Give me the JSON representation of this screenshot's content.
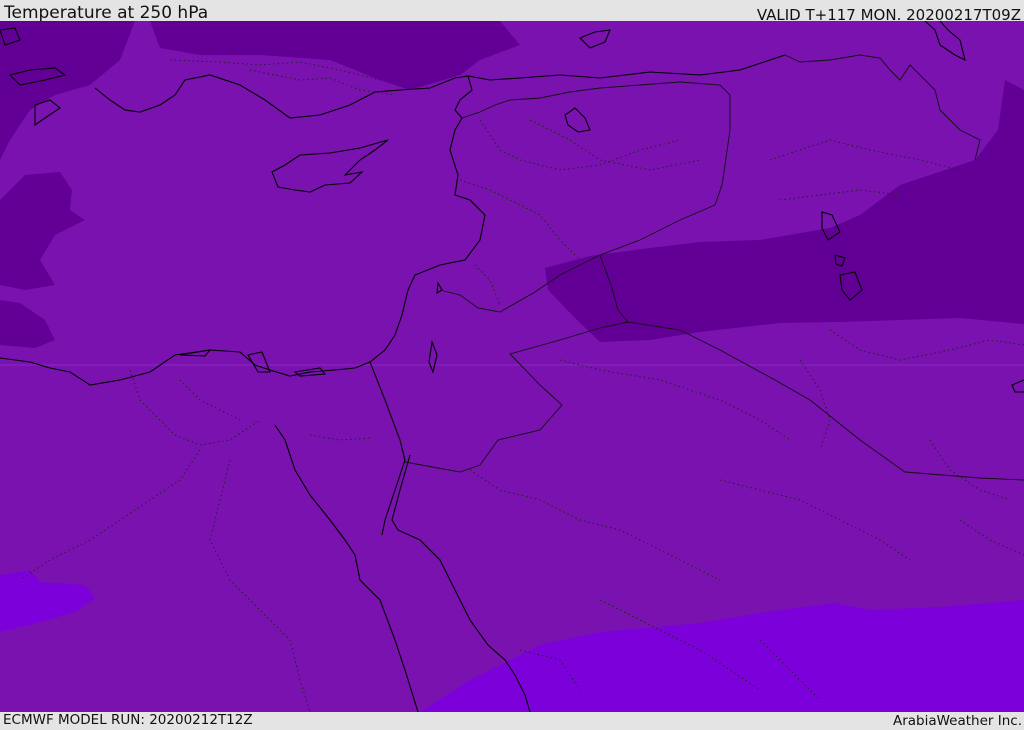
{
  "header": {
    "title": "Temperature at 250 hPa",
    "valid": "VALID T+117 MON. 20200217T09Z"
  },
  "footer": {
    "model_run": "ECMWF MODEL RUN: 20200212T12Z",
    "credit": "ArabiaWeather Inc."
  },
  "map": {
    "region": "Eastern Mediterranean / Middle East",
    "colors": {
      "band_purple": "#7a12b0",
      "band_dark": "#620096",
      "band_violet": "#7c00d9",
      "coastline": "#000000",
      "borders": "#111111"
    }
  }
}
